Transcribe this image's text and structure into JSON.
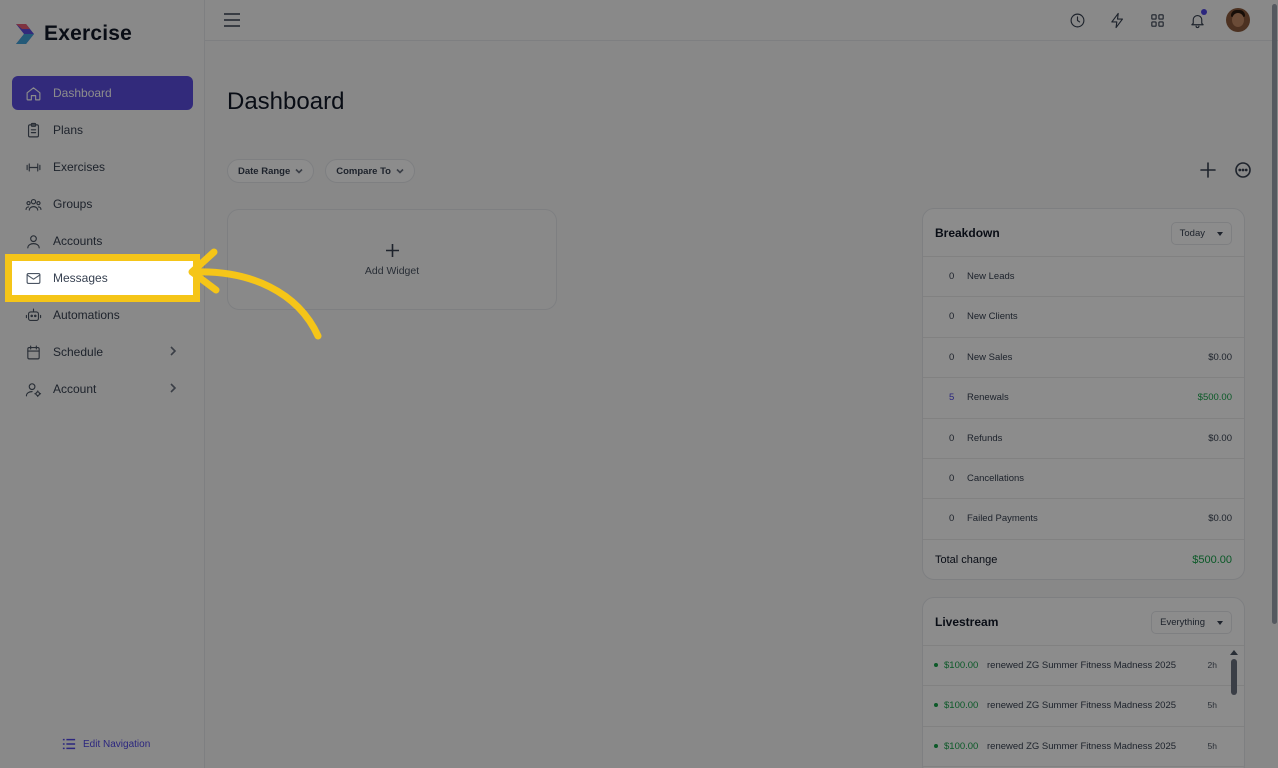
{
  "brand": {
    "name": "Exercise"
  },
  "sidebar": {
    "items": [
      {
        "label": "Dashboard",
        "icon": "home-icon"
      },
      {
        "label": "Plans",
        "icon": "clipboard-icon"
      },
      {
        "label": "Exercises",
        "icon": "dumbbell-icon"
      },
      {
        "label": "Groups",
        "icon": "users-icon"
      },
      {
        "label": "Accounts",
        "icon": "user-icon"
      },
      {
        "label": "Messages",
        "icon": "mail-icon"
      },
      {
        "label": "Automations",
        "icon": "robot-icon"
      },
      {
        "label": "Schedule",
        "icon": "calendar-icon"
      },
      {
        "label": "Account",
        "icon": "user-gear-icon"
      }
    ],
    "edit_nav": "Edit Navigation"
  },
  "page": {
    "title": "Dashboard"
  },
  "filters": {
    "date_range": "Date Range",
    "compare_to": "Compare To"
  },
  "widget": {
    "add_label": "Add Widget"
  },
  "breakdown": {
    "title": "Breakdown",
    "period": "Today",
    "rows": [
      {
        "count": "0",
        "label": "New Leads",
        "amount": ""
      },
      {
        "count": "0",
        "label": "New Clients",
        "amount": ""
      },
      {
        "count": "0",
        "label": "New Sales",
        "amount": "$0.00"
      },
      {
        "count": "5",
        "label": "Renewals",
        "amount": "$500.00"
      },
      {
        "count": "0",
        "label": "Refunds",
        "amount": "$0.00"
      },
      {
        "count": "0",
        "label": "Cancellations",
        "amount": ""
      },
      {
        "count": "0",
        "label": "Failed Payments",
        "amount": "$0.00"
      }
    ],
    "total_label": "Total change",
    "total_amount": "$500.00"
  },
  "livestream": {
    "title": "Livestream",
    "filter": "Everything",
    "items": [
      {
        "amount": "$100.00",
        "text": "renewed ZG Summer Fitness Madness 2025",
        "time": "2h"
      },
      {
        "amount": "$100.00",
        "text": "renewed ZG Summer Fitness Madness 2025",
        "time": "5h"
      },
      {
        "amount": "$100.00",
        "text": "renewed ZG Summer Fitness Madness 2025",
        "time": "5h"
      }
    ]
  },
  "colors": {
    "accent": "#5b4ee0",
    "highlight": "#f5c518",
    "positive": "#16a34a"
  }
}
